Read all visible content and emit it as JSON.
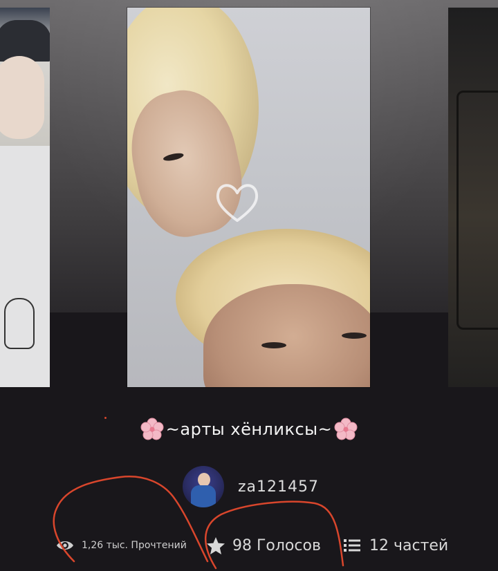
{
  "story": {
    "title": "~арты хёнликсы~",
    "author": "za121457"
  },
  "stats": {
    "reads": "1,26 тыс. Прочтений",
    "votes": "98 Голосов",
    "parts": "12 частей"
  },
  "icons": {
    "reads": "eye-icon",
    "votes": "star-icon",
    "parts": "list-icon",
    "title_decoration": "pink-flower-icon"
  },
  "colors": {
    "background": "#19171b",
    "annotation_stroke": "#d9462c",
    "flower": "#f3b9c6"
  }
}
